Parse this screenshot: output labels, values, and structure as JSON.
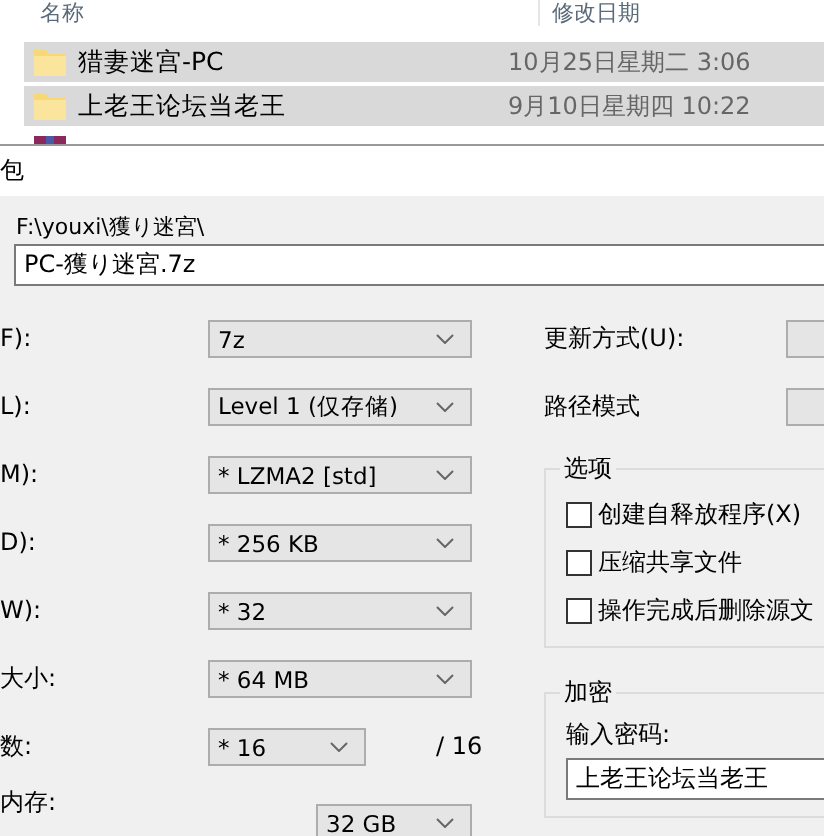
{
  "explorer": {
    "columns": [
      "名称",
      "修改日期"
    ],
    "rows": [
      {
        "name": "猎妻迷宫-PC",
        "date": "10月25日星期二 3:06",
        "selected": true,
        "kind": "folder"
      },
      {
        "name": "上老王论坛当老王",
        "date": "9月10日星期四 10:22",
        "selected": true,
        "kind": "folder"
      },
      {
        "kind": "archive",
        "selected": false
      }
    ]
  },
  "dialog": {
    "title": "包",
    "folder": "F:\\youxi\\獲り迷宮\\",
    "archive_name": "PC-獲り迷宮.7z",
    "settings": [
      {
        "label": "F):",
        "value": "7z"
      },
      {
        "label": "L):",
        "value": "Level 1 (仅存储)"
      },
      {
        "label": "M):",
        "value": "* LZMA2 [std]"
      },
      {
        "label": "D):",
        "value": "* 256 KB"
      },
      {
        "label": "W):",
        "value": "* 32"
      },
      {
        "label": "大小:",
        "value": "* 64 MB"
      },
      {
        "label": "数:",
        "value": "* 16",
        "suffix": "/ 16"
      }
    ],
    "memory": {
      "label": "内存:",
      "value": "32 GB"
    },
    "right_fields": [
      {
        "label": "更新方式(U):"
      },
      {
        "label": "路径模式"
      }
    ],
    "options": {
      "title": "选项",
      "items": [
        {
          "label": "创建自释放程序(X)",
          "checked": false
        },
        {
          "label": "压缩共享文件",
          "checked": false
        },
        {
          "label": "操作完成后删除源文",
          "checked": false
        }
      ]
    },
    "encryption": {
      "title": "加密",
      "prompt": "输入密码:",
      "password": "上老王论坛当老王"
    }
  }
}
